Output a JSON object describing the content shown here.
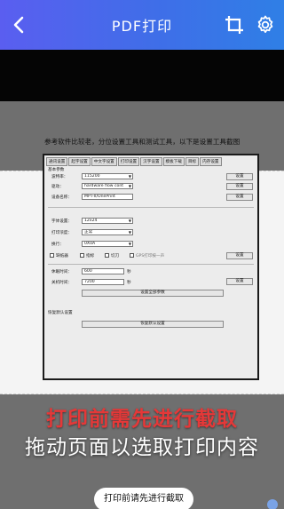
{
  "header": {
    "title": "PDF打印",
    "back_icon": "chevron-left-icon",
    "crop_icon": "crop-icon",
    "settings_icon": "gear-icon"
  },
  "document": {
    "caption": "参考软件比较老，分位设置工具和测试工具，以下是设置工具截图",
    "dialog": {
      "tabs": [
        "通讯设置",
        "起字设置",
        "中文字设置",
        "打印设置",
        "汉字设置",
        "模板下载",
        "目标",
        "内存设置"
      ],
      "group1": "基本参数",
      "baud_label": "波特率：",
      "baud_value": "115200",
      "driver_label": "驱动：",
      "driver_value": "hardware flow cont",
      "device_label": "设备名称：",
      "device_value": "MPT-II/OnePrint",
      "font_label": "字体设置：",
      "font_value": "12x24",
      "density_label": "打印浓度：",
      "density_value": "正常",
      "linefeed_label": "换行：",
      "linefeed_value": "0X0A",
      "check1": "缺纸器",
      "check2": "指标",
      "check3": "切刀",
      "check4": "GPS打印按一声",
      "sleep_label": "休眠时间：",
      "sleep_value": "600",
      "off_label": "关机时间：",
      "off_value": "7200",
      "unit": "秒",
      "set_btn": "设置",
      "set_all_btn": "设置全部参数",
      "restore_group": "恢复默认设置",
      "restore_btn": "恢复默认设置"
    }
  },
  "overlay": {
    "line1": "打印前需先进行截取",
    "line2": "拖动页面以选取打印内容",
    "line1_color": "#e53838"
  },
  "toast": {
    "text": "打印前请先进行截取"
  }
}
